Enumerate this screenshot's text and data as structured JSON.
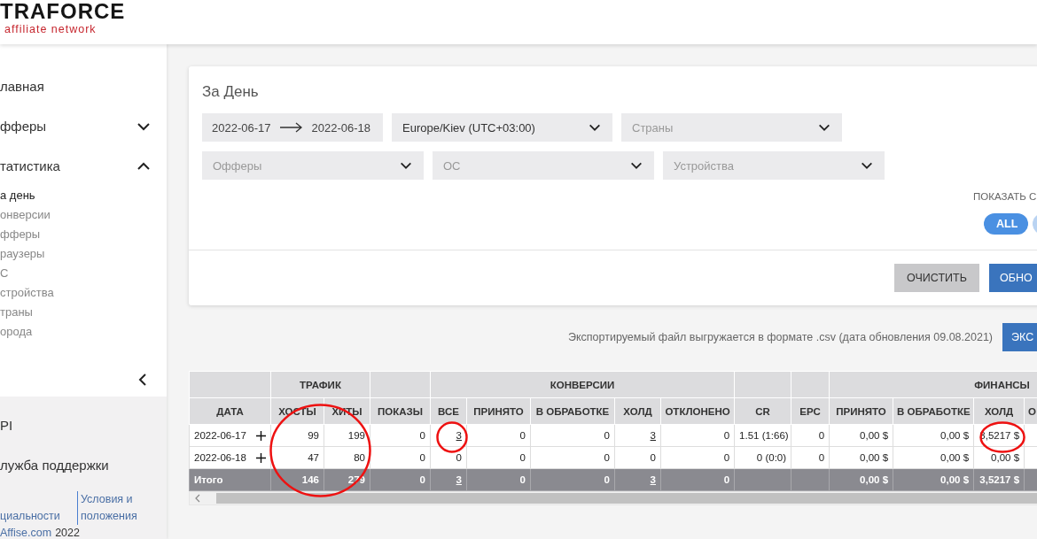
{
  "header": {
    "logo": "TRAFORCE",
    "tagline": "affiliate network"
  },
  "sidebar": {
    "items": [
      {
        "label": "лавная",
        "kind": "link"
      },
      {
        "label": "фферы",
        "kind": "group",
        "expanded": false
      },
      {
        "label": "татистика",
        "kind": "group",
        "expanded": true,
        "children": [
          {
            "label": "а день",
            "selected": true
          },
          {
            "label": "онверсии",
            "selected": false
          },
          {
            "label": "фферы",
            "selected": false
          },
          {
            "label": "раузеры",
            "selected": false
          },
          {
            "label": "С",
            "selected": false
          },
          {
            "label": "стройства",
            "selected": false
          },
          {
            "label": "траны",
            "selected": false
          },
          {
            "label": "орода",
            "selected": false
          }
        ]
      }
    ],
    "bottom_items": [
      "PI",
      "лужба поддержки"
    ],
    "footer_links": [
      "циальности",
      "Условия и положения"
    ],
    "copyright": {
      "site": "Affise.com",
      "year": "2022"
    }
  },
  "filter_card": {
    "title": "За День",
    "date_from": "2022-06-17",
    "date_to": "2022-06-18",
    "row1": [
      {
        "value": "Europe/Kiev (UTC+03:00)"
      },
      {
        "placeholder": "Страны"
      }
    ],
    "row2": [
      {
        "placeholder": "Офферы"
      },
      {
        "placeholder": "ОС"
      },
      {
        "placeholder": "Устройства"
      }
    ],
    "show_label": "ПОКАЗАТЬ С",
    "pills": [
      {
        "label": "ALL",
        "selected": true
      },
      {
        "selected": false
      }
    ],
    "buttons": [
      "ОЧИСТИТЬ",
      "ОБНО"
    ]
  },
  "export": {
    "note": "Экспортируемый файл выгружается в формате .csv (дата обновления 09.08.2021)",
    "button": "ЭКС"
  },
  "table": {
    "traffic_circled": true,
    "groups": [
      "ТРАФИК",
      "КОНВЕРСИИ",
      "ФИНАНСЫ"
    ],
    "columns": [
      "ДАТА",
      "ХОСТЫ",
      "ХИТЫ",
      "ПОКАЗЫ",
      "ВСЕ",
      "ПРИНЯТО",
      "В ОБРАБОТКЕ",
      "ХОЛД",
      "ОТКЛОНЕНО",
      "CR",
      "EPC",
      "ПРИНЯТО",
      "В ОБРАБОТКЕ",
      "ХОЛД",
      "О"
    ],
    "rows": [
      {
        "kind": "data",
        "cells": [
          "2022-06-17",
          "99",
          "199",
          "0",
          {
            "text": "3",
            "link": true,
            "circled": true
          },
          "0",
          "0",
          {
            "text": "3",
            "link": true
          },
          "0",
          "1.51 (1:66)",
          "0",
          "0,00 $",
          "0,00 $",
          {
            "text": "3,5217 $",
            "circled": true
          },
          ""
        ]
      },
      {
        "kind": "data",
        "cells": [
          "2022-06-18",
          "47",
          "80",
          "0",
          "0",
          "0",
          "0",
          "0",
          "0",
          "0 (0:0)",
          "0",
          "0,00 $",
          "0,00 $",
          "0,00 $",
          ""
        ]
      },
      {
        "kind": "total",
        "cells": [
          "Итого",
          "146",
          "279",
          "0",
          {
            "text": "3",
            "link": true
          },
          "0",
          "0",
          {
            "text": "3",
            "link": true
          },
          "0",
          "",
          "",
          "0,00 $",
          "0,00 $",
          "3,5217 $",
          ""
        ]
      }
    ]
  }
}
